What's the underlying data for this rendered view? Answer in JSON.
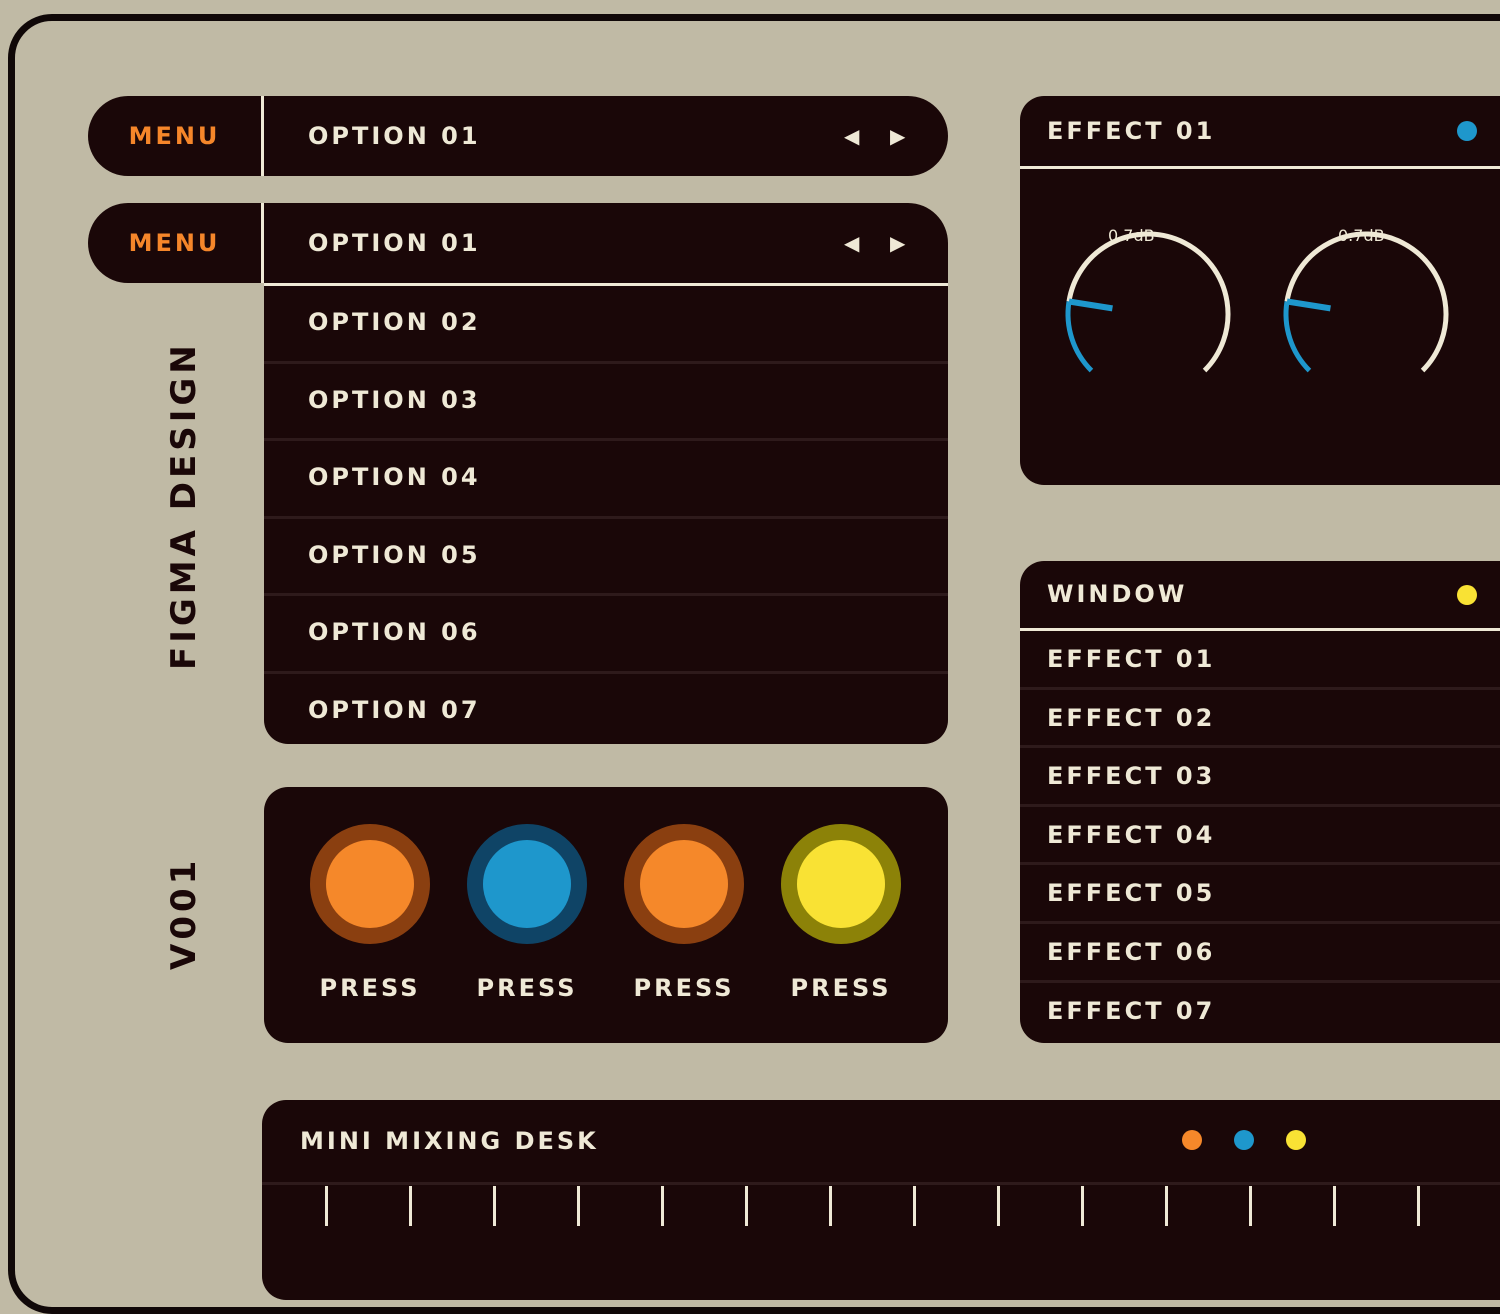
{
  "menu_bars": [
    {
      "menu_label": "MENU",
      "selected_option": "OPTION 01",
      "prev_icon": "triangle-left-icon",
      "next_icon": "triangle-right-icon"
    },
    {
      "menu_label": "MENU",
      "selected_option": "OPTION 01",
      "prev_icon": "triangle-left-icon",
      "next_icon": "triangle-right-icon"
    }
  ],
  "dropdown_options": [
    "OPTION 02",
    "OPTION 03",
    "OPTION 04",
    "OPTION 05",
    "OPTION 06",
    "OPTION 07"
  ],
  "side_labels": {
    "design": "FIGMA DESIGN",
    "version": "V001"
  },
  "press_buttons": [
    {
      "label": "PRESS",
      "fill": "#f5882a",
      "ring": "#8a3f10"
    },
    {
      "label": "PRESS",
      "fill": "#1e97cc",
      "ring": "#0f4466"
    },
    {
      "label": "PRESS",
      "fill": "#f5882a",
      "ring": "#8a3f10"
    },
    {
      "label": "PRESS",
      "fill": "#f9e234",
      "ring": "#8c8208"
    }
  ],
  "effect_panel": {
    "title": "EFFECT 01",
    "status_color": "#1e97cc",
    "knobs": [
      {
        "value_label": "0.7dB",
        "level": 0.2
      },
      {
        "value_label": "0.7dB",
        "level": 0.2
      }
    ]
  },
  "window_panel": {
    "title": "WINDOW",
    "status_color": "#f9e234",
    "items": [
      "EFFECT 01",
      "EFFECT 02",
      "EFFECT 03",
      "EFFECT 04",
      "EFFECT 05",
      "EFFECT 06",
      "EFFECT 07"
    ]
  },
  "mixer": {
    "title": "MINI MIXING DESK",
    "indicator_colors": [
      "#f5882a",
      "#1e97cc",
      "#f9e234"
    ],
    "channel_count": 14
  },
  "colors": {
    "background": "#c0baa5",
    "panel": "#1a0708",
    "text": "#efe9d6",
    "accent_orange": "#f5862a",
    "accent_blue": "#1e97cc",
    "accent_yellow": "#f9e234"
  }
}
